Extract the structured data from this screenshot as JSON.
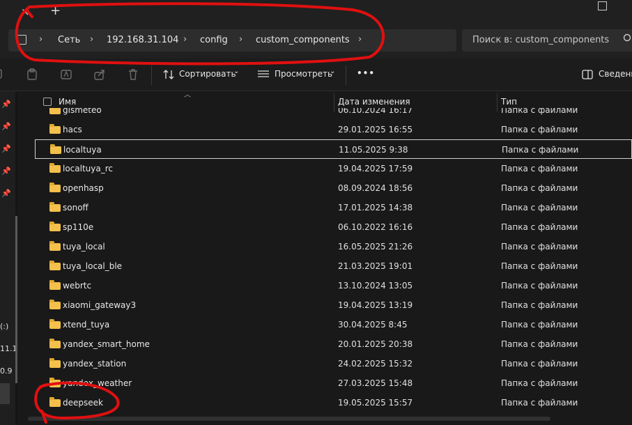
{
  "window": {
    "tab_close": "×",
    "new_tab": "+"
  },
  "address": {
    "crumbs": [
      "Сеть",
      "192.168.31.104",
      "config",
      "custom_components"
    ],
    "separator": "›"
  },
  "search": {
    "placeholder": "Поиск в: custom_components"
  },
  "toolbar": {
    "sort_label": "Сортировать",
    "view_label": "Просмотреть",
    "more_label": "•••",
    "details_label": "Сведени",
    "dropdown_glyph": "⌄"
  },
  "columns": {
    "name": "Имя",
    "modified": "Дата изменения",
    "type": "Тип"
  },
  "nav_fragments": [
    "(:)",
    "11.1",
    "0.9"
  ],
  "rows": [
    {
      "name": "gismeteo",
      "date": "06.10.2024 16:17",
      "type": "Папка с файлами"
    },
    {
      "name": "hacs",
      "date": "29.01.2025 16:55",
      "type": "Папка с файлами"
    },
    {
      "name": "localtuya",
      "date": "11.05.2025 9:38",
      "type": "Папка с файлами"
    },
    {
      "name": "localtuya_rc",
      "date": "19.04.2025 17:59",
      "type": "Папка с файлами"
    },
    {
      "name": "openhasp",
      "date": "08.09.2024 18:56",
      "type": "Папка с файлами"
    },
    {
      "name": "sonoff",
      "date": "17.01.2025 14:38",
      "type": "Папка с файлами"
    },
    {
      "name": "sp110e",
      "date": "06.10.2022 16:16",
      "type": "Папка с файлами"
    },
    {
      "name": "tuya_local",
      "date": "16.05.2025 21:26",
      "type": "Папка с файлами"
    },
    {
      "name": "tuya_local_ble",
      "date": "21.03.2025 19:01",
      "type": "Папка с файлами"
    },
    {
      "name": "webrtc",
      "date": "13.10.2024 13:05",
      "type": "Папка с файлами"
    },
    {
      "name": "xiaomi_gateway3",
      "date": "19.04.2025 13:19",
      "type": "Папка с файлами"
    },
    {
      "name": "xtend_tuya",
      "date": "30.04.2025 8:45",
      "type": "Папка с файлами"
    },
    {
      "name": "yandex_smart_home",
      "date": "20.01.2025 20:38",
      "type": "Папка с файлами"
    },
    {
      "name": "yandex_station",
      "date": "24.02.2025 15:32",
      "type": "Папка с файлами"
    },
    {
      "name": "yandex_weather",
      "date": "27.03.2025 15:48",
      "type": "Папка с файлами"
    },
    {
      "name": "deepseek",
      "date": "19.05.2025 15:57",
      "type": "Папка с файлами"
    }
  ],
  "focused_row": "localtuya",
  "colors": {
    "background": "#191919",
    "folder": "#f3c04b",
    "annotation": "#e01010"
  }
}
